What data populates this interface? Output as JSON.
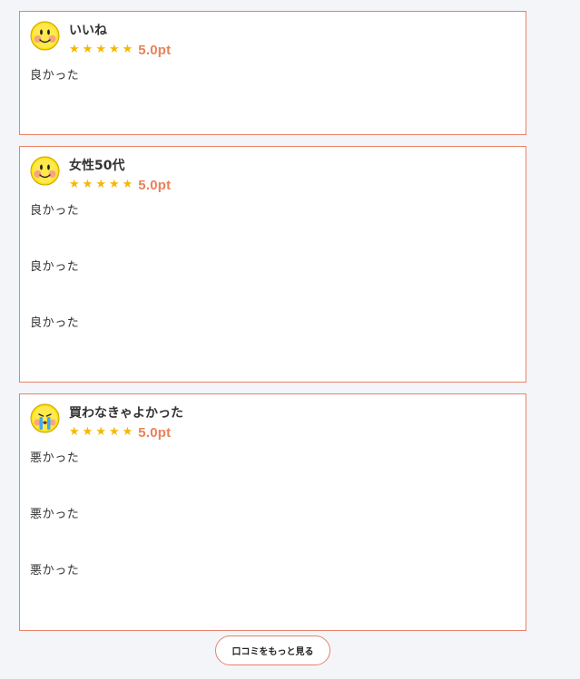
{
  "reviews": [
    {
      "title": "いいね",
      "avatar_icon": "smiley-face-icon",
      "stars": 5,
      "score": "5.0pt",
      "lines": [
        "良かった"
      ]
    },
    {
      "title": "女性50代",
      "avatar_icon": "smiley-face-icon",
      "stars": 5,
      "score": "5.0pt",
      "lines": [
        "良かった",
        "良かった",
        "良かった"
      ]
    },
    {
      "title": "買わなきゃよかった",
      "avatar_icon": "crying-face-icon",
      "stars": 5,
      "score": "5.0pt",
      "lines": [
        "悪かった",
        "悪かった",
        "悪かった"
      ]
    }
  ],
  "more_button": {
    "label": "口コミをもっと見る"
  },
  "colors": {
    "accent": "#e8826a",
    "star": "#f5b800",
    "score": "#e8825a",
    "background": "#f4f5f8"
  }
}
